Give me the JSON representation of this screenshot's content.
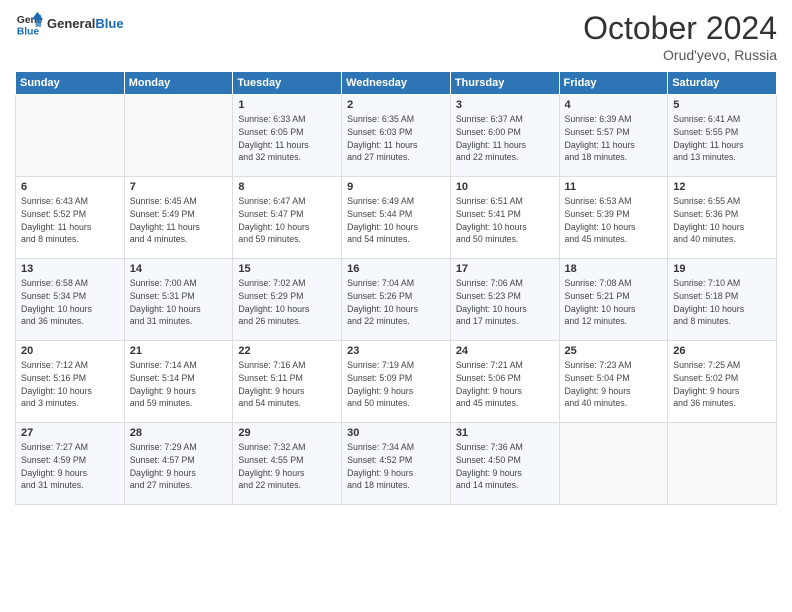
{
  "header": {
    "logo_general": "General",
    "logo_blue": "Blue",
    "main_title": "October 2024",
    "sub_title": "Orud'yevo, Russia"
  },
  "days_of_week": [
    "Sunday",
    "Monday",
    "Tuesday",
    "Wednesday",
    "Thursday",
    "Friday",
    "Saturday"
  ],
  "weeks": [
    [
      {
        "day": "",
        "info": ""
      },
      {
        "day": "",
        "info": ""
      },
      {
        "day": "1",
        "info": "Sunrise: 6:33 AM\nSunset: 6:05 PM\nDaylight: 11 hours\nand 32 minutes."
      },
      {
        "day": "2",
        "info": "Sunrise: 6:35 AM\nSunset: 6:03 PM\nDaylight: 11 hours\nand 27 minutes."
      },
      {
        "day": "3",
        "info": "Sunrise: 6:37 AM\nSunset: 6:00 PM\nDaylight: 11 hours\nand 22 minutes."
      },
      {
        "day": "4",
        "info": "Sunrise: 6:39 AM\nSunset: 5:57 PM\nDaylight: 11 hours\nand 18 minutes."
      },
      {
        "day": "5",
        "info": "Sunrise: 6:41 AM\nSunset: 5:55 PM\nDaylight: 11 hours\nand 13 minutes."
      }
    ],
    [
      {
        "day": "6",
        "info": "Sunrise: 6:43 AM\nSunset: 5:52 PM\nDaylight: 11 hours\nand 8 minutes."
      },
      {
        "day": "7",
        "info": "Sunrise: 6:45 AM\nSunset: 5:49 PM\nDaylight: 11 hours\nand 4 minutes."
      },
      {
        "day": "8",
        "info": "Sunrise: 6:47 AM\nSunset: 5:47 PM\nDaylight: 10 hours\nand 59 minutes."
      },
      {
        "day": "9",
        "info": "Sunrise: 6:49 AM\nSunset: 5:44 PM\nDaylight: 10 hours\nand 54 minutes."
      },
      {
        "day": "10",
        "info": "Sunrise: 6:51 AM\nSunset: 5:41 PM\nDaylight: 10 hours\nand 50 minutes."
      },
      {
        "day": "11",
        "info": "Sunrise: 6:53 AM\nSunset: 5:39 PM\nDaylight: 10 hours\nand 45 minutes."
      },
      {
        "day": "12",
        "info": "Sunrise: 6:55 AM\nSunset: 5:36 PM\nDaylight: 10 hours\nand 40 minutes."
      }
    ],
    [
      {
        "day": "13",
        "info": "Sunrise: 6:58 AM\nSunset: 5:34 PM\nDaylight: 10 hours\nand 36 minutes."
      },
      {
        "day": "14",
        "info": "Sunrise: 7:00 AM\nSunset: 5:31 PM\nDaylight: 10 hours\nand 31 minutes."
      },
      {
        "day": "15",
        "info": "Sunrise: 7:02 AM\nSunset: 5:29 PM\nDaylight: 10 hours\nand 26 minutes."
      },
      {
        "day": "16",
        "info": "Sunrise: 7:04 AM\nSunset: 5:26 PM\nDaylight: 10 hours\nand 22 minutes."
      },
      {
        "day": "17",
        "info": "Sunrise: 7:06 AM\nSunset: 5:23 PM\nDaylight: 10 hours\nand 17 minutes."
      },
      {
        "day": "18",
        "info": "Sunrise: 7:08 AM\nSunset: 5:21 PM\nDaylight: 10 hours\nand 12 minutes."
      },
      {
        "day": "19",
        "info": "Sunrise: 7:10 AM\nSunset: 5:18 PM\nDaylight: 10 hours\nand 8 minutes."
      }
    ],
    [
      {
        "day": "20",
        "info": "Sunrise: 7:12 AM\nSunset: 5:16 PM\nDaylight: 10 hours\nand 3 minutes."
      },
      {
        "day": "21",
        "info": "Sunrise: 7:14 AM\nSunset: 5:14 PM\nDaylight: 9 hours\nand 59 minutes."
      },
      {
        "day": "22",
        "info": "Sunrise: 7:16 AM\nSunset: 5:11 PM\nDaylight: 9 hours\nand 54 minutes."
      },
      {
        "day": "23",
        "info": "Sunrise: 7:19 AM\nSunset: 5:09 PM\nDaylight: 9 hours\nand 50 minutes."
      },
      {
        "day": "24",
        "info": "Sunrise: 7:21 AM\nSunset: 5:06 PM\nDaylight: 9 hours\nand 45 minutes."
      },
      {
        "day": "25",
        "info": "Sunrise: 7:23 AM\nSunset: 5:04 PM\nDaylight: 9 hours\nand 40 minutes."
      },
      {
        "day": "26",
        "info": "Sunrise: 7:25 AM\nSunset: 5:02 PM\nDaylight: 9 hours\nand 36 minutes."
      }
    ],
    [
      {
        "day": "27",
        "info": "Sunrise: 7:27 AM\nSunset: 4:59 PM\nDaylight: 9 hours\nand 31 minutes."
      },
      {
        "day": "28",
        "info": "Sunrise: 7:29 AM\nSunset: 4:57 PM\nDaylight: 9 hours\nand 27 minutes."
      },
      {
        "day": "29",
        "info": "Sunrise: 7:32 AM\nSunset: 4:55 PM\nDaylight: 9 hours\nand 22 minutes."
      },
      {
        "day": "30",
        "info": "Sunrise: 7:34 AM\nSunset: 4:52 PM\nDaylight: 9 hours\nand 18 minutes."
      },
      {
        "day": "31",
        "info": "Sunrise: 7:36 AM\nSunset: 4:50 PM\nDaylight: 9 hours\nand 14 minutes."
      },
      {
        "day": "",
        "info": ""
      },
      {
        "day": "",
        "info": ""
      }
    ]
  ]
}
